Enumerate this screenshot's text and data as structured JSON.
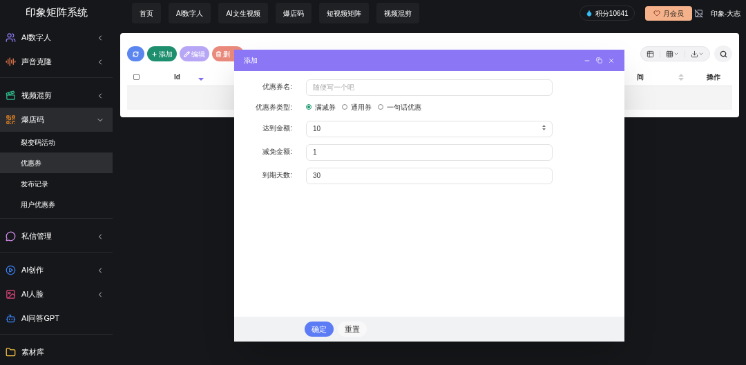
{
  "app": {
    "title": "印象矩阵系统"
  },
  "nav": {
    "tabs": [
      {
        "label": "首页"
      },
      {
        "label": "AI数字人"
      },
      {
        "label": "AI文生视频"
      },
      {
        "label": "爆店码"
      },
      {
        "label": "短视频矩阵"
      },
      {
        "label": "视频混剪"
      }
    ]
  },
  "account": {
    "points": "积分10641",
    "membership": "月会员",
    "user": "印象-大志"
  },
  "sidebar": {
    "sections": [
      [
        {
          "label": "AI数字人",
          "expanded": false
        },
        {
          "label": "声音克隆",
          "expanded": false
        }
      ],
      [
        {
          "label": "视频混剪",
          "expanded": false
        },
        {
          "label": "爆店码",
          "expanded": true,
          "children": [
            {
              "label": "裂变码活动",
              "selected": false
            },
            {
              "label": "优惠券",
              "selected": true
            },
            {
              "label": "发布记录",
              "selected": false
            },
            {
              "label": "用户优惠券",
              "selected": false
            }
          ]
        }
      ],
      [
        {
          "label": "私信管理",
          "expanded": false
        }
      ],
      [
        {
          "label": "AI创作",
          "expanded": false
        },
        {
          "label": "AI人脸",
          "expanded": false
        },
        {
          "label": "AI问答GPT"
        }
      ],
      [
        {
          "label": "素材库"
        }
      ]
    ]
  },
  "toolbar": {
    "buttons": [
      {
        "kind": "refresh"
      },
      {
        "kind": "add",
        "label": "添加"
      },
      {
        "kind": "edit",
        "label": "编辑"
      },
      {
        "kind": "delete",
        "label": "删"
      }
    ]
  },
  "table": {
    "select_all": {
      "checked": false
    },
    "columns": [
      {
        "label": "Id",
        "sorted": true
      },
      {
        "label": "间",
        "sorted": false
      },
      {
        "label": "操作"
      }
    ]
  },
  "dialog": {
    "title": "添加",
    "fields": [
      {
        "kind": "text",
        "label": "优惠券名:",
        "placeholder": "随便写一个吧"
      },
      {
        "kind": "radio",
        "label": "优惠券类型:",
        "options": [
          {
            "label": "满减券",
            "selected": true
          },
          {
            "label": "通用券",
            "selected": false
          },
          {
            "label": "一句话优惠",
            "selected": false
          }
        ]
      },
      {
        "kind": "number",
        "label": "达到金额:",
        "value": "10"
      },
      {
        "kind": "text",
        "label": "减免金额:",
        "value": "1"
      },
      {
        "kind": "text",
        "label": "到期天数:",
        "value": "30"
      }
    ],
    "buttons": [
      {
        "kind": "primary",
        "label": "确定"
      },
      {
        "kind": "default",
        "label": "重置"
      }
    ]
  }
}
